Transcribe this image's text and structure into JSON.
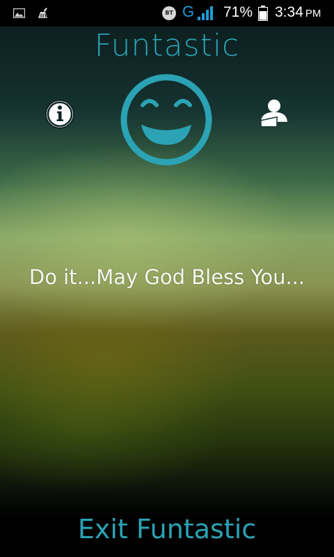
{
  "status_bar": {
    "left_icons": [
      "gallery-icon",
      "cleaner-icon"
    ],
    "bluetooth_label": "BT",
    "network_type": "G",
    "battery_percent": "71%",
    "time": "3:34",
    "ampm": "PM"
  },
  "app": {
    "title": "Funtastic",
    "message": "Do it...May God Bless You...",
    "exit_label": "Exit Funtastic"
  },
  "icons": {
    "info": "info-icon",
    "mood": "smiley-face-icon",
    "profile": "user-profile-icon"
  },
  "colors": {
    "accent": "#2ba3b4",
    "network": "#1d9bd6",
    "text": "#f4f6ee"
  }
}
